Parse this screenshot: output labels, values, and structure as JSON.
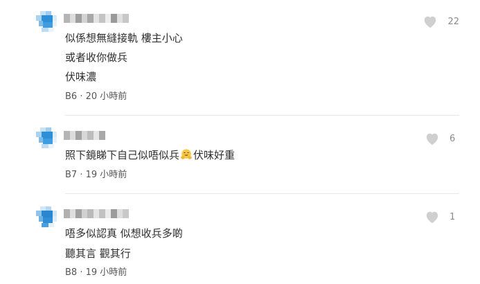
{
  "comments": [
    {
      "lines": [
        "似係想無縫接軌 樓主小心",
        "或者收你做兵",
        "伏味濃"
      ],
      "floor": "B6",
      "time": "20 小時前",
      "likes": "22"
    },
    {
      "line_before_emoji": "照下鏡睇下自己似唔似兵",
      "emoji": "smiling-face-with-open-hands-emoji",
      "line_after_emoji": "伏味好重",
      "floor": "B7",
      "time": "19 小時前",
      "likes": "6"
    },
    {
      "lines": [
        "唔多似認真 似想收兵多啲",
        "聽其言 觀其行"
      ],
      "floor": "B8",
      "time": "19 小時前",
      "likes": "1"
    }
  ],
  "meta_separator": "·",
  "icons": {
    "like": "heart-icon",
    "avatar": "pixelated-avatar"
  },
  "colors": {
    "heart": "#cfcfcf",
    "avatar_blue": "#2f8fd6",
    "avatar_light": "#a9d3f2"
  }
}
